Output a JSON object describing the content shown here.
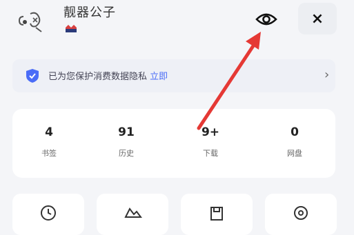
{
  "header": {
    "username": "靓器公子",
    "eye_icon": "eye-icon",
    "close_label": "×"
  },
  "notice": {
    "text": "已为您保护消费数据隐私",
    "link": "立即",
    "chevron": "›"
  },
  "stats": [
    {
      "value": "4",
      "label": "书签"
    },
    {
      "value": "91",
      "label": "历史"
    },
    {
      "value": "9+",
      "label": "下载"
    },
    {
      "value": "0",
      "label": "网盘"
    }
  ],
  "colors": {
    "arrow": "#e53935",
    "accent": "#4a6cf7",
    "badge": "#d84040"
  }
}
